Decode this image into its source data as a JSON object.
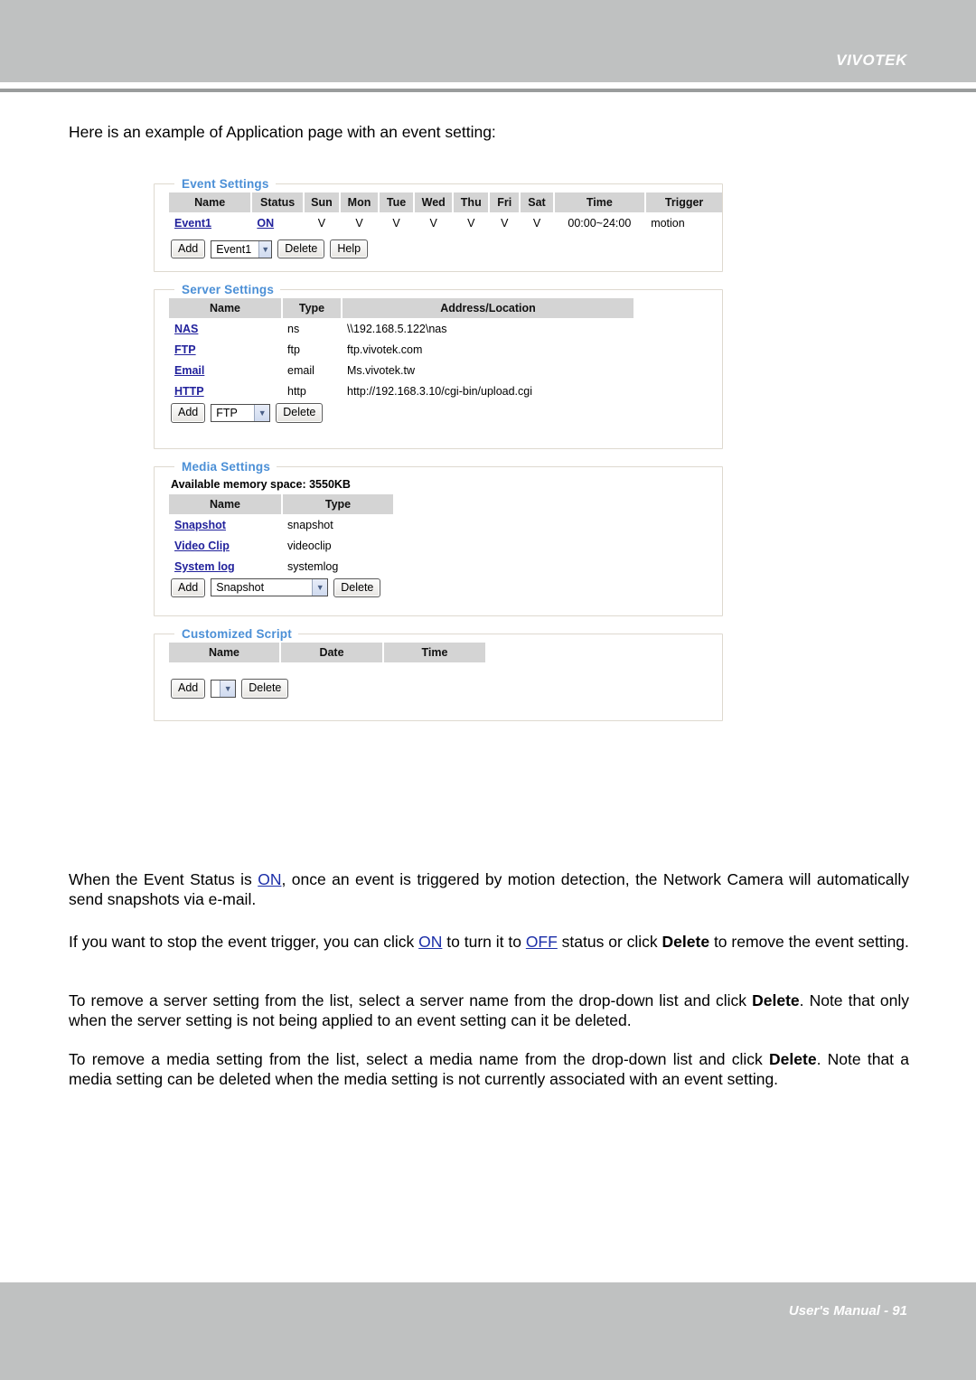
{
  "header": {
    "brand": "VIVOTEK"
  },
  "footer": {
    "text": "User's Manual - 91"
  },
  "intro": "Here is an example of Application page with an event setting:",
  "colors": {
    "header_bg": "#bfc1c1",
    "legend_blue": "#4b8fd6",
    "link_blue": "#22229c",
    "table_header_bg": "#d4d4d4"
  },
  "ui": {
    "event_settings": {
      "legend": "Event Settings",
      "columns": [
        "Name",
        "Status",
        "Sun",
        "Mon",
        "Tue",
        "Wed",
        "Thu",
        "Fri",
        "Sat",
        "Time",
        "Trigger"
      ],
      "rows": [
        {
          "name": "Event1",
          "status": "ON",
          "sun": "V",
          "mon": "V",
          "tue": "V",
          "wed": "V",
          "thu": "V",
          "fri": "V",
          "sat": "V",
          "time": "00:00~24:00",
          "trigger": "motion"
        }
      ],
      "controls": {
        "add_label": "Add",
        "select_value": "Event1",
        "delete_label": "Delete",
        "help_label": "Help"
      }
    },
    "server_settings": {
      "legend": "Server Settings",
      "columns": [
        "Name",
        "Type",
        "Address/Location"
      ],
      "rows": [
        {
          "name": "NAS",
          "type": "ns",
          "address": "\\\\192.168.5.122\\nas"
        },
        {
          "name": "FTP",
          "type": "ftp",
          "address": "ftp.vivotek.com"
        },
        {
          "name": "Email",
          "type": "email",
          "address": "Ms.vivotek.tw"
        },
        {
          "name": "HTTP",
          "type": "http",
          "address": "http://192.168.3.10/cgi-bin/upload.cgi"
        }
      ],
      "controls": {
        "add_label": "Add",
        "select_value": "FTP",
        "delete_label": "Delete"
      }
    },
    "media_settings": {
      "legend": "Media Settings",
      "memory_note": "Available memory space: 3550KB",
      "columns": [
        "Name",
        "Type"
      ],
      "rows": [
        {
          "name": "Snapshot",
          "type": "snapshot"
        },
        {
          "name": "Video Clip",
          "type": "videoclip"
        },
        {
          "name": "System log",
          "type": "systemlog"
        }
      ],
      "controls": {
        "add_label": "Add",
        "select_value": "Snapshot",
        "delete_label": "Delete"
      }
    },
    "customized_script": {
      "legend": "Customized Script",
      "columns": [
        "Name",
        "Date",
        "Time"
      ],
      "rows": [],
      "controls": {
        "add_label": "Add",
        "select_value": "",
        "delete_label": "Delete"
      }
    }
  },
  "paragraphs": {
    "p1": {
      "a": "When the Event Status is ",
      "link1": "ON",
      "b": ", once an event is triggered by motion detection, the Network Camera will automatically send snapshots via e-mail."
    },
    "p2": {
      "a": "If you want to stop the event trigger, you can click ",
      "link1": "ON",
      "b": " to turn it to ",
      "link2": "OFF",
      "c": " status or click ",
      "bold1": "Delete",
      "d": " to remove the event setting."
    },
    "p3": {
      "a": "To remove a server setting from the list, select a server name from the drop-down list and click ",
      "bold1": "Delete",
      "b": ". Note that only when the server setting is not being applied to an event setting can it be deleted."
    },
    "p4": {
      "a": "To remove a media setting from the list, select a media name from the drop-down list and click ",
      "bold1": "Delete",
      "b": ". Note that a media setting can be deleted when the media setting is not currently associated with an event setting."
    }
  }
}
